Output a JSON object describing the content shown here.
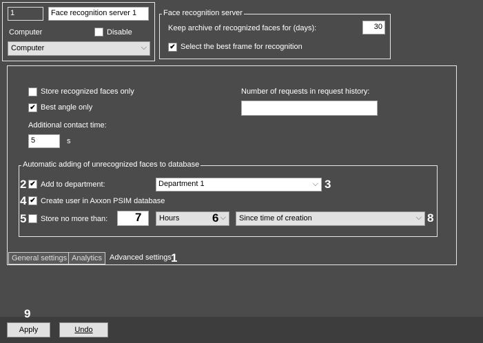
{
  "header": {
    "id": "1",
    "name": "Face recognition server 1",
    "computer_label": "Computer",
    "disable_label": "Disable",
    "disable_checked": false,
    "computer_value": "Computer"
  },
  "server": {
    "legend": "Face recognition server",
    "keep_label": "Keep archive of recognized faces for (days):",
    "keep_value": "30",
    "best_frame_label": "Select the best frame for recognition",
    "best_frame_checked": true
  },
  "advanced": {
    "store_only": "Store recognized faces only",
    "best_angle": "Best angle only",
    "contact_label": "Additional contact time:",
    "contact_value": "5",
    "contact_unit": "s",
    "requests_label": "Number of requests in request history:",
    "requests_value": ""
  },
  "auto": {
    "legend": "Automatic adding of unrecognized faces to database",
    "add_dept": "Add to department:",
    "dept_value": "Department 1",
    "create_user": "Create user in Axxon PSIM database",
    "store_no_more": "Store no more than:",
    "store_value": "",
    "unit": "Hours",
    "since": "Since time of creation"
  },
  "tabs": [
    "General settings",
    "Analytics",
    "Advanced settings"
  ],
  "annotations": [
    "1",
    "2",
    "3",
    "4",
    "5",
    "6",
    "7",
    "8",
    "9"
  ],
  "footer": {
    "apply": "Apply",
    "undo": "Undo"
  },
  "checks": {
    "✓": "✔"
  }
}
